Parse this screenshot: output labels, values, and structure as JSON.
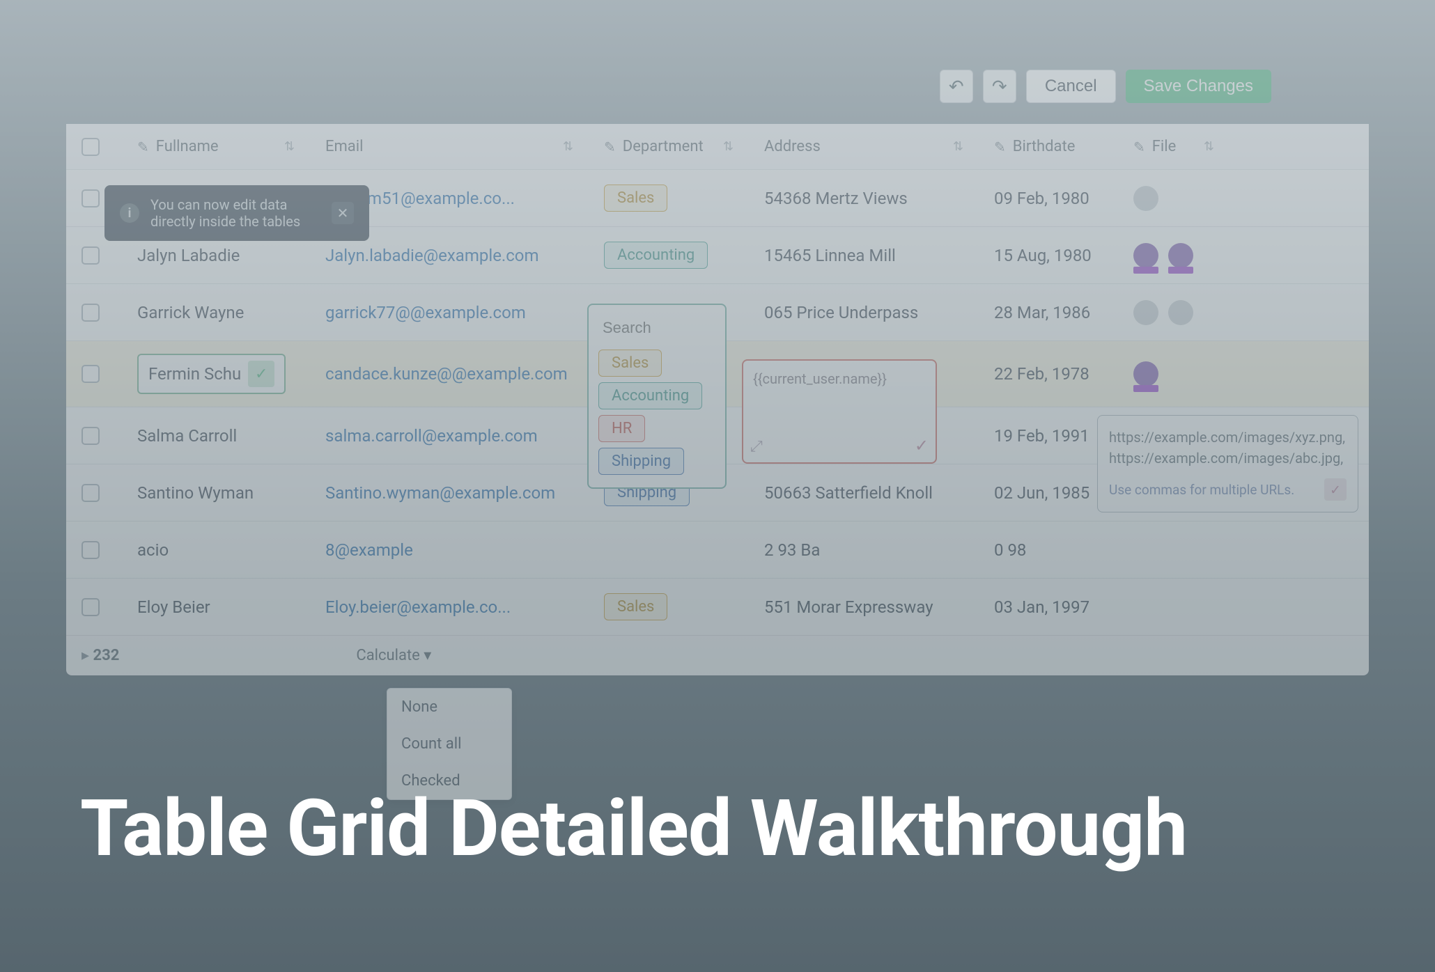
{
  "hero": "Table Grid Detailed Walkthrough",
  "toolbar": {
    "cancel": "Cancel",
    "save": "Save Changes"
  },
  "tooltip": {
    "text": "You can now edit data directly inside the tables"
  },
  "columns": {
    "fullname": "Fullname",
    "email": "Email",
    "department": "Department",
    "address": "Address",
    "birthdate": "Birthdate",
    "file": "File"
  },
  "rows": [
    {
      "name": "",
      "email": "chumm51@example.co...",
      "dept": "Sales",
      "deptClass": "pill-sales",
      "addr": "54368 Mertz Views",
      "birth": "09 Feb, 1980"
    },
    {
      "name": "Jalyn Labadie",
      "email": "Jalyn.labadie@example.com",
      "dept": "Accounting",
      "deptClass": "pill-acct",
      "addr": "15465 Linnea Mill",
      "birth": "15 Aug, 1980"
    },
    {
      "name": "Garrick Wayne",
      "email": "garrick77@@example.com",
      "dept": "",
      "deptClass": "",
      "addr": "065 Price Underpass",
      "birth": "28 Mar, 1986"
    },
    {
      "name": "Fermin Schu",
      "email": "candace.kunze@@example.com",
      "dept": "Accounting",
      "deptClass": "pill-acct",
      "addr": "",
      "birth": "22 Feb, 1978"
    },
    {
      "name": "Salma Carroll",
      "email": "salma.carroll@example.com",
      "dept": "HR",
      "deptClass": "pill-hr",
      "addr": "",
      "birth": "19 Feb, 1991"
    },
    {
      "name": "Santino Wyman",
      "email": "Santino.wyman@example.com",
      "dept": "Shipping",
      "deptClass": "pill-ship",
      "addr": "50663 Satterfield Knoll",
      "birth": "02 Jun, 1985"
    },
    {
      "name": "acio",
      "email": "8@example",
      "dept": "",
      "deptClass": "",
      "addr": "2  93 Ba",
      "birth": "0     98"
    },
    {
      "name": "Eloy Beier",
      "email": "Eloy.beier@example.co...",
      "dept": "Sales",
      "deptClass": "pill-sales",
      "addr": "551 Morar Expressway",
      "birth": "03 Jan, 1997"
    }
  ],
  "footer": {
    "count_label": "232",
    "calculate": "Calculate"
  },
  "dept_dropdown": {
    "placeholder": "Search",
    "options": [
      "Sales",
      "Accounting",
      "HR",
      "Shipping"
    ]
  },
  "addr_popup": {
    "value": "{{current_user.name}}"
  },
  "file_popup": {
    "urls": "https://example.com/images/xyz.png, https://example.com/images/abc.jpg,",
    "hint": "Use commas for multiple URLs."
  },
  "calc_menu": [
    "None",
    "Count all",
    "Checked"
  ]
}
